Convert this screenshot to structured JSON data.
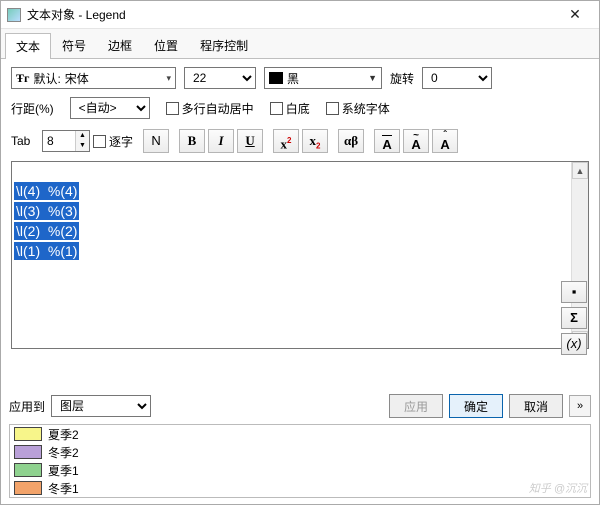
{
  "titlebar": {
    "title": "文本对象 - Legend"
  },
  "tabs": [
    "文本",
    "符号",
    "边框",
    "位置",
    "程序控制"
  ],
  "active_tab": 0,
  "font": {
    "prefix": "默认:",
    "name": "宋体"
  },
  "size": "22",
  "color_label": "黑",
  "rotate_label": "旋转",
  "rotate_value": "0",
  "row2": {
    "linesp_label": "行距(%)",
    "linesp_value": "<自动>",
    "multiline": "多行自动居中",
    "whitebg": "白底",
    "sysfont": "系统字体"
  },
  "row3": {
    "tab_label": "Tab",
    "tab_value": "8",
    "verbatim": "逐字"
  },
  "editor_lines": [
    "\\l(4)  %(4)",
    "\\l(3)  %(3)",
    "\\l(2)  %(2)",
    "\\l(1)  %(1)"
  ],
  "side_buttons": [
    "▪",
    "Σ",
    "(x)"
  ],
  "apply_to_label": "应用到",
  "apply_to_value": "图层",
  "buttons": {
    "apply": "应用",
    "ok": "确定",
    "cancel": "取消"
  },
  "legend": [
    {
      "color": "#f7f58a",
      "name": "夏季2"
    },
    {
      "color": "#b9a0d8",
      "name": "冬季2"
    },
    {
      "color": "#8fd28f",
      "name": "夏季1"
    },
    {
      "color": "#f2a36a",
      "name": "冬季1"
    }
  ],
  "watermark": "知乎 @沉沉"
}
